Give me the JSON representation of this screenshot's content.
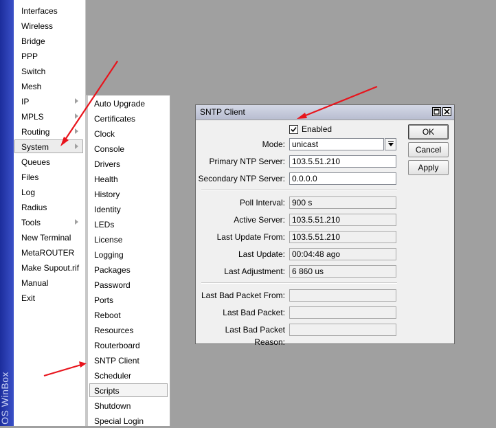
{
  "brand_text": "OS WinBox",
  "main_menu": [
    {
      "label": "Interfaces",
      "submenu": false
    },
    {
      "label": "Wireless",
      "submenu": false
    },
    {
      "label": "Bridge",
      "submenu": false
    },
    {
      "label": "PPP",
      "submenu": false
    },
    {
      "label": "Switch",
      "submenu": false
    },
    {
      "label": "Mesh",
      "submenu": false
    },
    {
      "label": "IP",
      "submenu": true
    },
    {
      "label": "MPLS",
      "submenu": true
    },
    {
      "label": "Routing",
      "submenu": true
    },
    {
      "label": "System",
      "submenu": true,
      "selected": true
    },
    {
      "label": "Queues",
      "submenu": false
    },
    {
      "label": "Files",
      "submenu": false
    },
    {
      "label": "Log",
      "submenu": false
    },
    {
      "label": "Radius",
      "submenu": false
    },
    {
      "label": "Tools",
      "submenu": true
    },
    {
      "label": "New Terminal",
      "submenu": false
    },
    {
      "label": "MetaROUTER",
      "submenu": false
    },
    {
      "label": "Make Supout.rif",
      "submenu": false
    },
    {
      "label": "Manual",
      "submenu": false
    },
    {
      "label": "Exit",
      "submenu": false
    }
  ],
  "system_submenu": [
    {
      "label": "Auto Upgrade"
    },
    {
      "label": "Certificates"
    },
    {
      "label": "Clock"
    },
    {
      "label": "Console"
    },
    {
      "label": "Drivers"
    },
    {
      "label": "Health"
    },
    {
      "label": "History"
    },
    {
      "label": "Identity"
    },
    {
      "label": "LEDs"
    },
    {
      "label": "License"
    },
    {
      "label": "Logging"
    },
    {
      "label": "Packages"
    },
    {
      "label": "Password"
    },
    {
      "label": "Ports"
    },
    {
      "label": "Reboot"
    },
    {
      "label": "Resources"
    },
    {
      "label": "Routerboard"
    },
    {
      "label": "SNTP Client"
    },
    {
      "label": "Scheduler"
    },
    {
      "label": "Scripts",
      "selected": true
    },
    {
      "label": "Shutdown"
    },
    {
      "label": "Special Login"
    }
  ],
  "sntp_window": {
    "title": "SNTP Client",
    "enabled_label": "Enabled",
    "enabled_checked": true,
    "fields": {
      "mode": {
        "label": "Mode:",
        "value": "unicast"
      },
      "primary_server": {
        "label": "Primary NTP Server:",
        "value": "103.5.51.210"
      },
      "secondary_server": {
        "label": "Secondary NTP Server:",
        "value": "0.0.0.0"
      },
      "poll_interval": {
        "label": "Poll Interval:",
        "value": "900 s"
      },
      "active_server": {
        "label": "Active Server:",
        "value": "103.5.51.210"
      },
      "last_update_from": {
        "label": "Last Update From:",
        "value": "103.5.51.210"
      },
      "last_update": {
        "label": "Last Update:",
        "value": "00:04:48 ago"
      },
      "last_adjustment": {
        "label": "Last Adjustment:",
        "value": "6 860 us"
      },
      "last_bad_packet_from": {
        "label": "Last Bad Packet From:",
        "value": ""
      },
      "last_bad_packet": {
        "label": "Last Bad Packet:",
        "value": ""
      },
      "last_bad_packet_reason": {
        "label": "Last Bad Packet Reason:",
        "value": ""
      }
    },
    "buttons": {
      "ok": "OK",
      "cancel": "Cancel",
      "apply": "Apply"
    }
  },
  "colors": {
    "annotation_arrow": "#e8141c",
    "sidebar_band": "#2a3fb8"
  }
}
